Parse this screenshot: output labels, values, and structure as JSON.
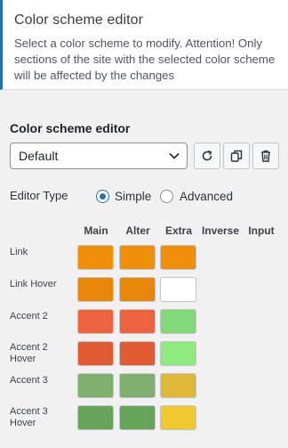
{
  "header": {
    "title": "Color scheme editor",
    "description": "Select a color scheme to modify. Attention! Only sections of the site with the selected color scheme will be affected by the changes"
  },
  "editor": {
    "section_title": "Color scheme editor",
    "selected_scheme": "Default",
    "editor_type_label": "Editor Type",
    "editor_types": [
      "Simple",
      "Advanced"
    ],
    "editor_type_selected": "Simple"
  },
  "columns": [
    "Main",
    "Alter",
    "Extra",
    "Inverse",
    "Input"
  ],
  "rows": [
    {
      "label": "Link",
      "colors": [
        "#f0900a",
        "#f0900a",
        "#f0900a"
      ]
    },
    {
      "label": "Link Hover",
      "colors": [
        "#e8880a",
        "#e8880a",
        "#ffffff"
      ]
    },
    {
      "label": "Accent 2",
      "colors": [
        "#ee6440",
        "#ee6440",
        "#82d97a"
      ]
    },
    {
      "label": "Accent 2 Hover",
      "colors": [
        "#e05a32",
        "#e05a32",
        "#8fea80"
      ]
    },
    {
      "label": "Accent 3",
      "colors": [
        "#80b070",
        "#80b070",
        "#e0b838"
      ]
    },
    {
      "label": "Accent 3 Hover",
      "colors": [
        "#66a45a",
        "#66a45a",
        "#f0c830"
      ]
    }
  ],
  "icons": {
    "refresh": "refresh-icon",
    "copy": "copy-icon",
    "delete": "trash-icon",
    "dropdown": "chevron-down-icon"
  },
  "colors": {
    "accent": "#2271b1"
  }
}
